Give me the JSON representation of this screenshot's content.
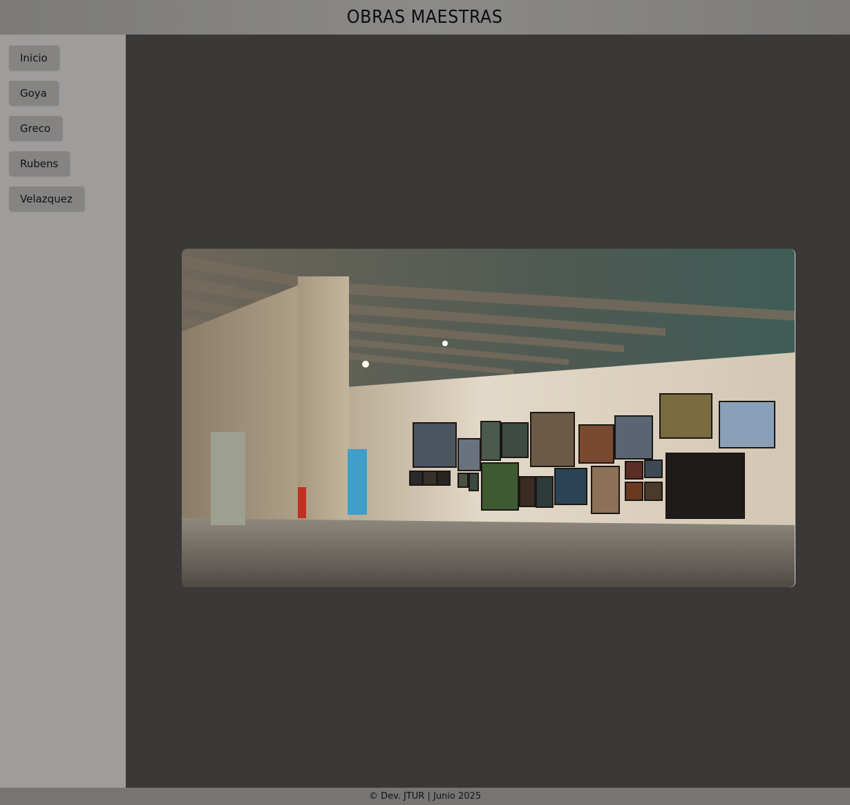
{
  "header": {
    "title": "OBRAS MAESTRAS"
  },
  "sidebar": {
    "items": [
      {
        "label": "Inicio"
      },
      {
        "label": "Goya"
      },
      {
        "label": "Greco"
      },
      {
        "label": "Rubens"
      },
      {
        "label": "Velazquez"
      }
    ]
  },
  "main": {
    "image": {
      "subject": "museum gallery hall with framed photographs on a wall"
    }
  },
  "footer": {
    "text": "© Dev. JTUR | Junio 2025"
  },
  "colors": {
    "header": "#868583",
    "sidebar": "#9e9d9c",
    "button": "#858483",
    "main": "#3a3938",
    "footer": "#767574"
  }
}
